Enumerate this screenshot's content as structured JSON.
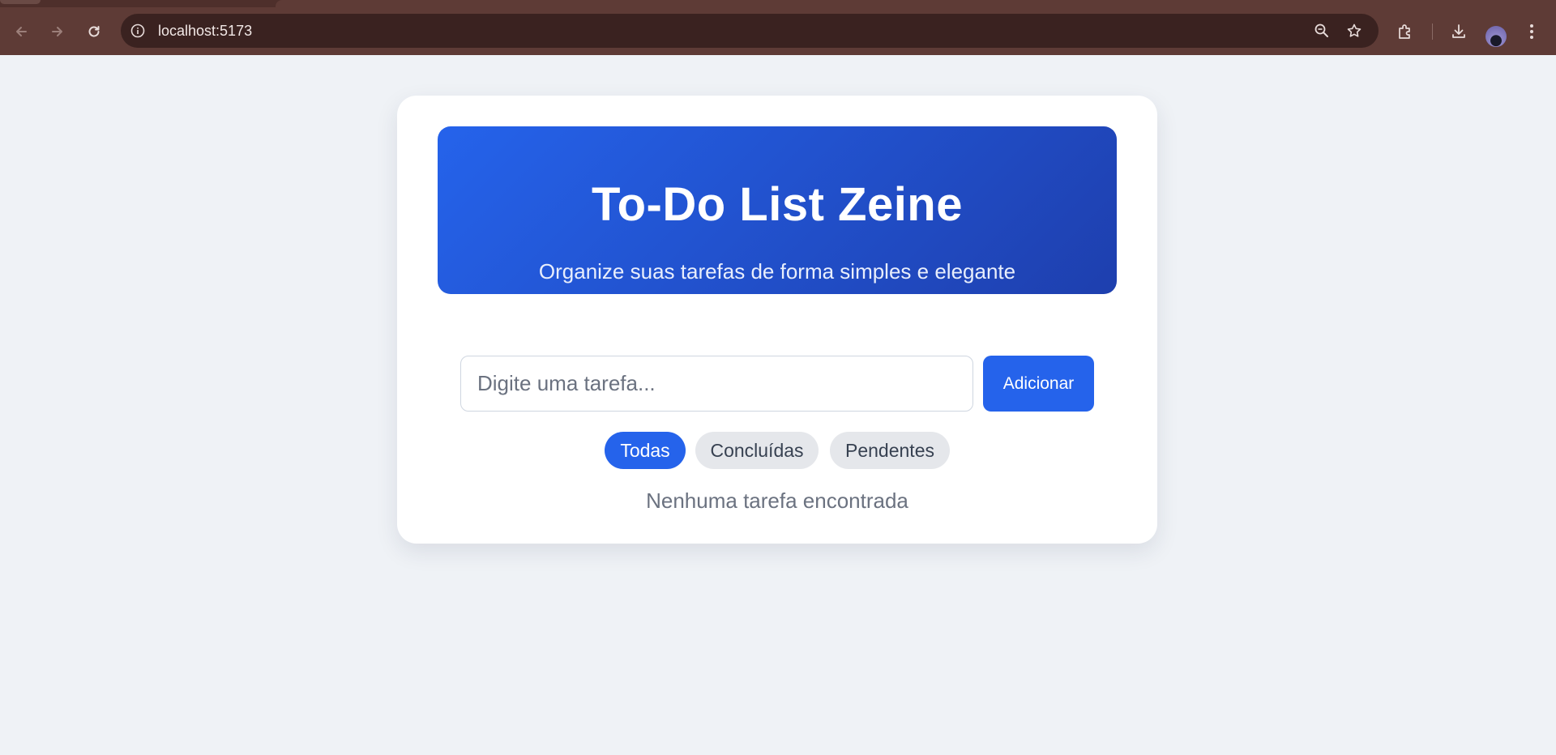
{
  "browser": {
    "url": "localhost:5173",
    "icons": {
      "back": "arrow-left-icon",
      "forward": "arrow-right-icon",
      "reload": "reload-icon",
      "site_info": "info-icon",
      "zoom": "zoom-icon",
      "bookmark": "star-icon",
      "extensions": "puzzle-icon",
      "downloads": "download-icon",
      "profile": "avatar",
      "menu": "kebab-menu-icon"
    }
  },
  "app": {
    "title": "To-Do List Zeine",
    "subtitle": "Organize suas tarefas de forma simples e elegante",
    "input": {
      "placeholder": "Digite uma tarefa...",
      "value": ""
    },
    "add_button": "Adicionar",
    "filters": [
      {
        "label": "Todas",
        "active": true
      },
      {
        "label": "Concluídas",
        "active": false
      },
      {
        "label": "Pendentes",
        "active": false
      }
    ],
    "empty_message": "Nenhuma tarefa encontrada"
  },
  "colors": {
    "primary": "#2563eb",
    "hero_gradient_end": "#1e3fae",
    "page_background": "#eff2f6",
    "chrome": "#5e3b36"
  }
}
